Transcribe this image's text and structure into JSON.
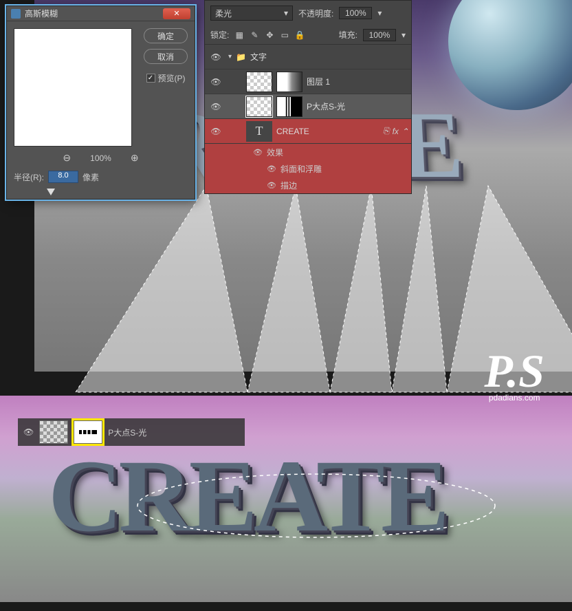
{
  "dialog": {
    "title": "高斯模糊",
    "ok": "确定",
    "cancel": "取消",
    "preview_label": "预览(P)",
    "preview_checked": true,
    "zoom_percent": "100%",
    "radius_label": "半径(R):",
    "radius_value": "8.0",
    "radius_unit": "像素"
  },
  "layers_panel": {
    "blend_mode": "柔光",
    "opacity_label": "不透明度:",
    "opacity_value": "100%",
    "lock_label": "锁定:",
    "fill_label": "填充:",
    "fill_value": "100%",
    "group_name": "文字",
    "layer1_name": "图层 1",
    "layer2_name": "P大点S-光",
    "text_layer_name": "CREATE",
    "fx_label": "fx",
    "effects_label": "效果",
    "effect1": "斜面和浮雕",
    "effect2": "描边"
  },
  "mini_layer": {
    "name": "P大点S-光"
  },
  "canvas": {
    "main_text": "CREATE"
  },
  "watermark": {
    "main": "P.S",
    "sub": "pdadians.com"
  }
}
